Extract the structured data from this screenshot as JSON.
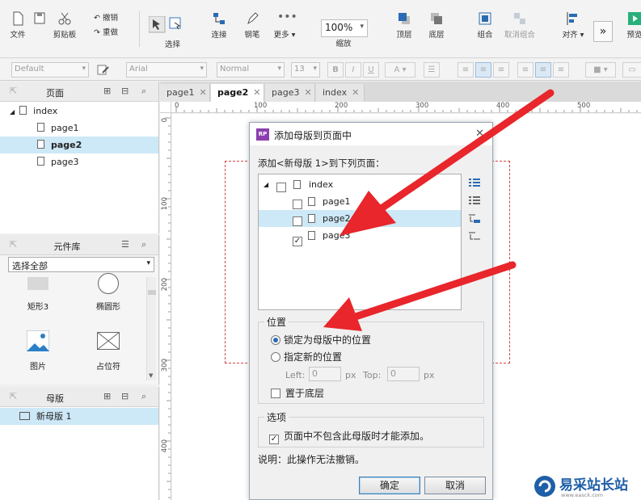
{
  "toolbar": {
    "file": "文件",
    "clipboard": "剪贴板",
    "undo": "撤销",
    "redo": "重做",
    "select": "选择",
    "connect": "连接",
    "pen": "钢笔",
    "more": "更多 ▾",
    "zoom": "100%",
    "zoom_label": "缩放",
    "top": "顶层",
    "bottom": "底层",
    "group": "组合",
    "ungroup": "取消组合",
    "align": "对齐 ▾",
    "preview": "预览"
  },
  "format_bar": {
    "style": "Default",
    "font": "Arial",
    "weight": "Normal",
    "size": "13"
  },
  "pages_panel": {
    "title": "页面",
    "items": [
      "index",
      "page1",
      "page2",
      "page3"
    ],
    "selected": "page2"
  },
  "widgets_panel": {
    "title": "元件库",
    "filter": "选择全部",
    "items": [
      "矩形3",
      "椭圆形",
      "图片",
      "占位符"
    ]
  },
  "masters_panel": {
    "title": "母版",
    "items": [
      "新母版 1"
    ]
  },
  "tabs": [
    {
      "label": "page1",
      "active": false
    },
    {
      "label": "page2",
      "active": true
    },
    {
      "label": "page3",
      "active": false
    },
    {
      "label": "index",
      "active": false
    }
  ],
  "ruler": {
    "h": [
      "0",
      "100",
      "200",
      "300",
      "400",
      "500"
    ],
    "v": [
      "0",
      "100",
      "200",
      "300",
      "400"
    ]
  },
  "dialog": {
    "title": "添加母版到页面中",
    "prompt": "添加<新母版 1>到下列页面：",
    "tree": [
      {
        "label": "index",
        "checked": false
      },
      {
        "label": "page1",
        "checked": false
      },
      {
        "label": "page2",
        "checked": false
      },
      {
        "label": "page3",
        "checked": true
      }
    ],
    "position_title": "位置",
    "lock_option": "锁定为母版中的位置",
    "new_option": "指定新的位置",
    "left_label": "Left:",
    "left_value": "0",
    "top_label": "Top:",
    "top_value": "0",
    "unit": "px",
    "send_to_bottom": "置于底层",
    "options_title": "选项",
    "options_check": "页面中不包含此母版时才能添加。",
    "note": "说明：此操作无法撤销。",
    "ok": "确定",
    "cancel": "取消"
  },
  "watermark": {
    "name": "易采站长站",
    "url": "www.easck.com"
  },
  "colors": {
    "arrow": "#e8262b",
    "selection": "#cde8f6",
    "accent": "#2a6bb3"
  }
}
